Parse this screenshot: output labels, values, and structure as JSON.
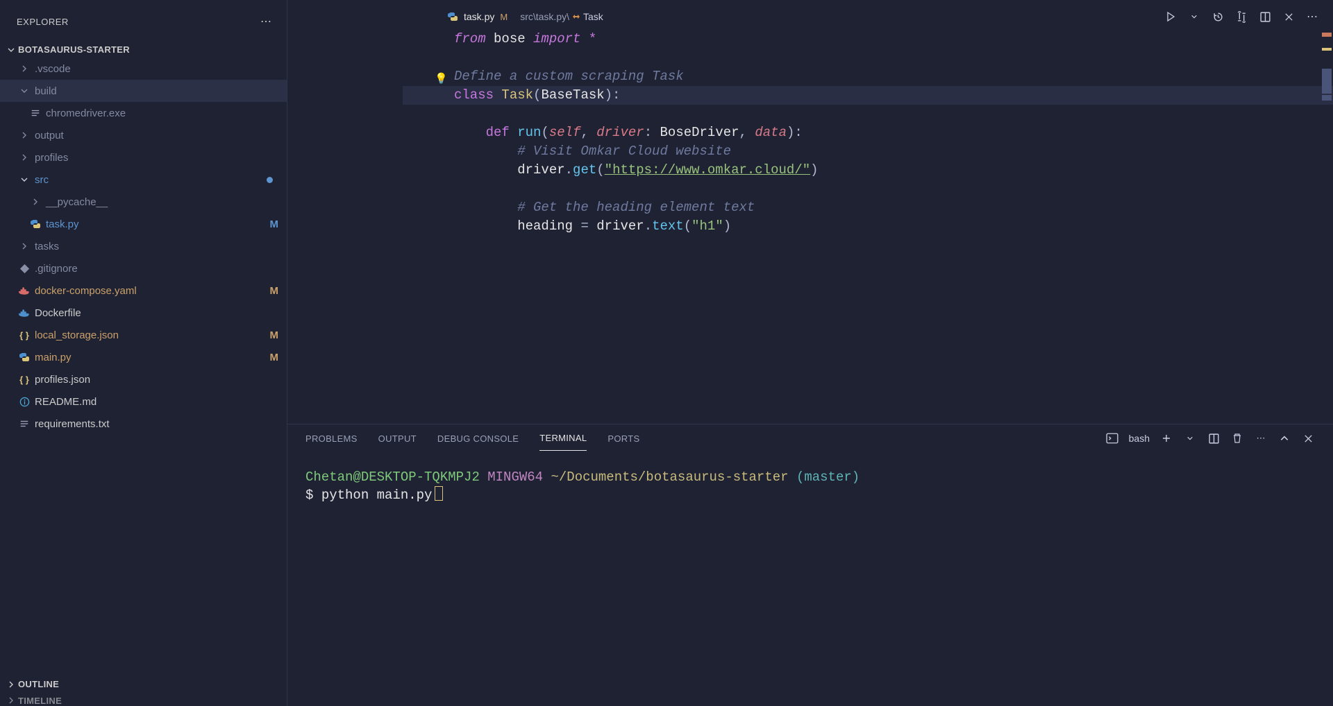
{
  "sidebar": {
    "title": "EXPLORER",
    "project": "BOTASAURUS-STARTER",
    "bottom_panels": [
      "OUTLINE",
      "TIMELINE"
    ]
  },
  "tree": [
    {
      "name": ".vscode",
      "type": "folder",
      "open": false,
      "indent": 0,
      "dim": true
    },
    {
      "name": "build",
      "type": "folder",
      "open": true,
      "indent": 0,
      "dim": true,
      "active": true
    },
    {
      "name": "chromedriver.exe",
      "type": "file",
      "icon": "text",
      "indent": 1,
      "dim": true
    },
    {
      "name": "output",
      "type": "folder",
      "open": false,
      "indent": 0,
      "dim": true
    },
    {
      "name": "profiles",
      "type": "folder",
      "open": false,
      "indent": 0,
      "dim": true
    },
    {
      "name": "src",
      "type": "folder",
      "open": true,
      "indent": 0,
      "dim": false,
      "status": "dot",
      "color": "#5e94cf"
    },
    {
      "name": "__pycache__",
      "type": "folder",
      "open": false,
      "indent": 1,
      "dim": true
    },
    {
      "name": "task.py",
      "type": "file",
      "icon": "python",
      "indent": 1,
      "dim": false,
      "status": "M",
      "color": "#5e94cf"
    },
    {
      "name": "tasks",
      "type": "folder",
      "open": false,
      "indent": 0,
      "dim": true
    },
    {
      "name": ".gitignore",
      "type": "file",
      "icon": "git",
      "indent": 0,
      "dim": true
    },
    {
      "name": "docker-compose.yaml",
      "type": "file",
      "icon": "docker-red",
      "indent": 0,
      "dim": false,
      "status": "M",
      "color": "#cba16a"
    },
    {
      "name": "Dockerfile",
      "type": "file",
      "icon": "docker-blue",
      "indent": 0,
      "dim": false
    },
    {
      "name": "local_storage.json",
      "type": "file",
      "icon": "json",
      "indent": 0,
      "dim": false,
      "status": "M",
      "color": "#cba16a"
    },
    {
      "name": "main.py",
      "type": "file",
      "icon": "python",
      "indent": 0,
      "dim": false,
      "status": "M",
      "color": "#cba16a",
      "iconcolor": "#4e8fce"
    },
    {
      "name": "profiles.json",
      "type": "file",
      "icon": "json",
      "indent": 0,
      "dim": false
    },
    {
      "name": "README.md",
      "type": "file",
      "icon": "info",
      "indent": 0,
      "dim": false
    },
    {
      "name": "requirements.txt",
      "type": "file",
      "icon": "text",
      "indent": 0,
      "dim": false
    }
  ],
  "tab": {
    "filename": "task.py",
    "status": "M",
    "breadcrumb_path": "src\\task.py\\",
    "breadcrumb_symbol": "Task"
  },
  "code": {
    "l1_from": "from",
    "l1_mod": "bose",
    "l1_imp": "import",
    "l1_star": "*",
    "l3_com": "Define a custom scraping Task",
    "l4_class": "class",
    "l4_name": "Task",
    "l4_base": "BaseTask",
    "l6_def": "def",
    "l6_fn": "run",
    "l6_self": "self",
    "l6_p1": "driver",
    "l6_t1": "BoseDriver",
    "l6_p2": "data",
    "l7_com": "# Visit Omkar Cloud website",
    "l8_v": "driver",
    "l8_m": "get",
    "l8_url": "\"https://www.omkar.cloud/\"",
    "l10_com": "# Get the heading element text",
    "l11_v": "heading",
    "l11_d": "driver",
    "l11_m": "text",
    "l11_arg": "\"h1\""
  },
  "panel": {
    "tabs": [
      "PROBLEMS",
      "OUTPUT",
      "DEBUG CONSOLE",
      "TERMINAL",
      "PORTS"
    ],
    "active_tab": "TERMINAL",
    "shell_name": "bash"
  },
  "terminal": {
    "user": "Chetan@DESKTOP-TQKMPJ2",
    "host": "MINGW64",
    "path": "~/Documents/botasaurus-starter",
    "branch": "(master)",
    "prompt": "$",
    "command": "python main.py"
  }
}
